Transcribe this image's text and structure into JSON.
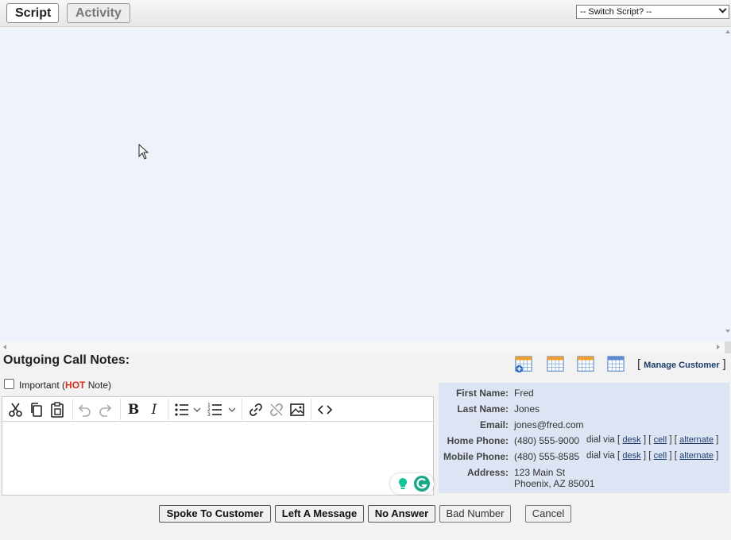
{
  "tabs": {
    "script": "Script",
    "activity": "Activity"
  },
  "switch_script": {
    "selected": "-- Switch Script? --"
  },
  "notes": {
    "title": "Outgoing Call Notes:",
    "important_prefix": "Important (",
    "hot": "HOT",
    "important_suffix": " Note)",
    "manage_customer": "Manage Customer"
  },
  "customer": {
    "first_name_label": "First Name:",
    "first_name": "Fred",
    "last_name_label": "Last Name:",
    "last_name": "Jones",
    "email_label": "Email:",
    "email": "jones@fred.com",
    "home_phone_label": "Home Phone:",
    "home_phone": "(480) 555-9000",
    "mobile_phone_label": "Mobile Phone:",
    "mobile_phone": "(480) 555-8585",
    "address_label": "Address:",
    "address_line1": "123 Main St",
    "address_line2": "Phoenix, AZ 85001",
    "dial_via": "dial via",
    "desk": "desk",
    "cell": "cell",
    "alternate": "alternate"
  },
  "editor": {
    "bold": "B",
    "italic": "I"
  },
  "buttons": {
    "spoke": "Spoke To Customer",
    "left_message": "Left A Message",
    "no_answer": "No Answer",
    "bad_number": "Bad Number",
    "cancel": "Cancel"
  }
}
